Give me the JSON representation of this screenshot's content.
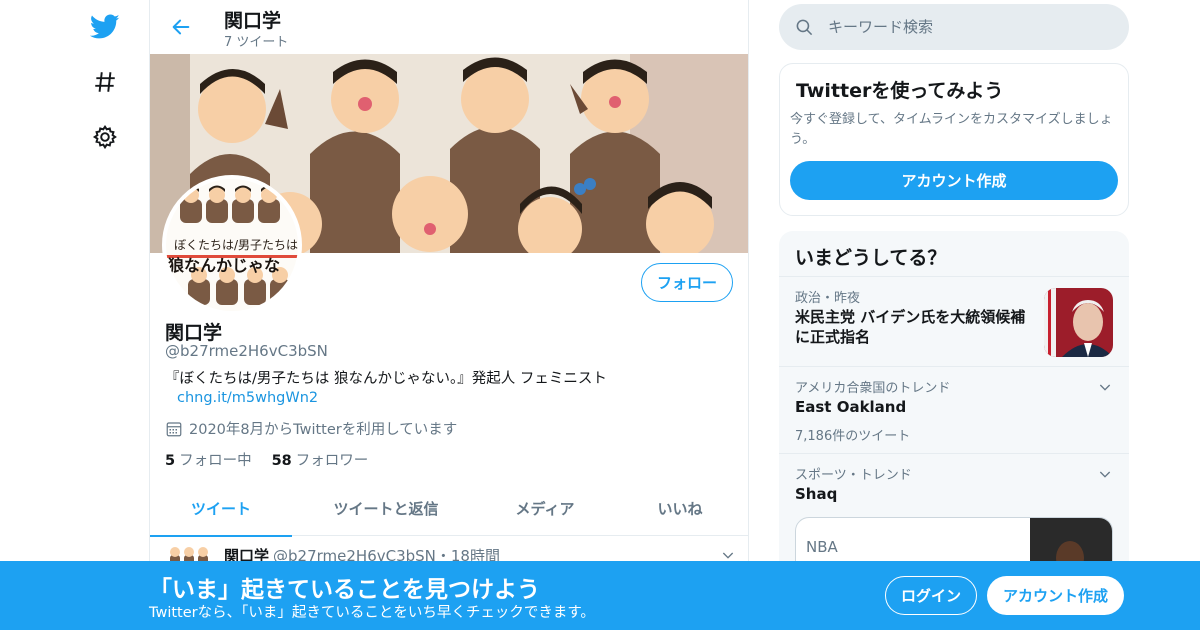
{
  "colors": {
    "accent": "#1da1f2",
    "text": "#14171a",
    "muted": "#657786",
    "border": "#e6ecf0",
    "bottom_bar": "#1da1f2"
  },
  "left_nav": {
    "icons": [
      "twitter-logo-icon",
      "hashtag-icon",
      "gear-icon"
    ]
  },
  "profile_header": {
    "name": "関口学",
    "tweet_count": "7 ツイート"
  },
  "profile": {
    "name": "関口学",
    "handle": "@b27rme2H6vC3bSN",
    "bio": "『ぼくたちは/男子たちは 狼なんかじゃない。』発起人 フェミニスト",
    "bio_link": "chng.it/m5whgWn2",
    "joined": "2020年8月からTwitterを利用しています",
    "following_count": "5",
    "following_label": "フォロー中",
    "followers_count": "58",
    "followers_label": "フォロワー",
    "follow_button": "フォロー",
    "avatar_text_line1": "ぼくたちは/男子たちは",
    "avatar_text_line2": "狼なんかじゃな"
  },
  "tabs": [
    {
      "label": "ツイート",
      "active": true
    },
    {
      "label": "ツイートと返信",
      "active": false
    },
    {
      "label": "メディア",
      "active": false
    },
    {
      "label": "いいね",
      "active": false
    }
  ],
  "tweet": {
    "author": "関口学",
    "handle_time": "@b27rme2H6vC3bSN・18時間"
  },
  "search": {
    "placeholder": "キーワード検索"
  },
  "signup_card": {
    "title": "Twitterを使ってみよう",
    "description": "今すぐ登録して、タイムラインをカスタマイズしましょう。",
    "button": "アカウント作成"
  },
  "trends_card": {
    "title": "いまどうしてる？",
    "items": [
      {
        "context": "政治・昨夜",
        "title": "米民主党 バイデン氏を大統領候補に正式指名",
        "count": ""
      },
      {
        "context": "アメリカ合衆国のトレンド",
        "title": "East Oakland",
        "count": "7,186件のツイート"
      },
      {
        "context": "スポーツ・トレンド",
        "title": "Shaq",
        "count": ""
      }
    ],
    "embedded_card_label": "NBA"
  },
  "bottom_bar": {
    "title": "「いま」起きていることを見つけよう",
    "subtitle": "Twitterなら、「いま」起きていることをいち早くチェックできます。",
    "login": "ログイン",
    "signup": "アカウント作成"
  }
}
